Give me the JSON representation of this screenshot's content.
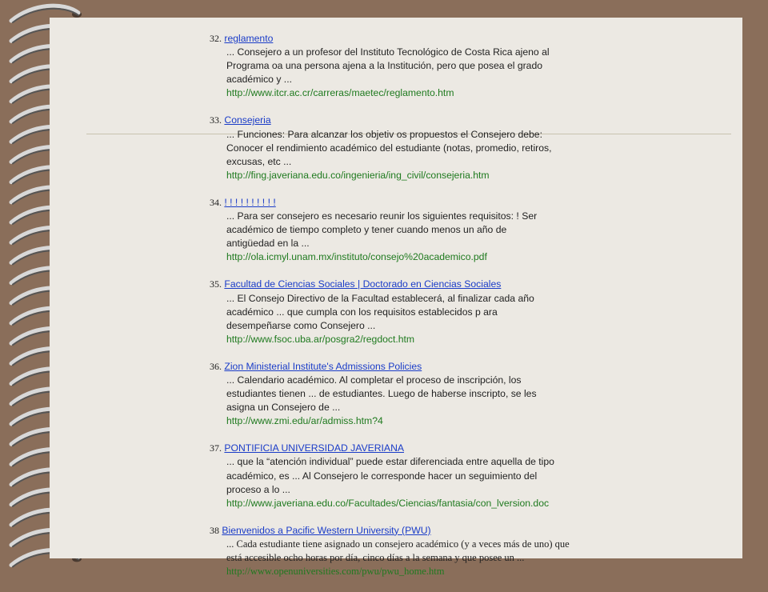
{
  "entries": [
    {
      "number": "32.",
      "title": "reglamento",
      "lines": [
        "... Consejero a un profesor del Instituto Tecnológico de Costa Rica ajeno al",
        "Programa oa una persona ajena a la Institución, pero que posea el grado",
        "académico y ..."
      ],
      "url": "http://www.itcr.ac.cr/carreras/maetec/reglamento.htm"
    },
    {
      "number": "33.",
      "title": "Consejeria",
      "lines": [
        "... Funciones: Para alcanzar los objetiv os propuestos el Consejero debe:",
        "Conocer el rendimiento académico del estudiante (notas, promedio, retiros,",
        "excusas, etc ..."
      ],
      "url": "http://fing.javeriana.edu.co/ingenieria/ing_civil/consejeria.htm"
    },
    {
      "number": "34.",
      "title": "! ! ! ! ! ! ! ! ! !",
      "lines": [
        "... Para ser consejero es necesario reunir los siguientes requisitos: ! Ser",
        "académico de tiempo completo y tener cuando menos un año de",
        "antigüedad en la ..."
      ],
      "url": "http://ola.icmyl.unam.mx/instituto/consejo%20academico.pdf"
    },
    {
      "number": "35.",
      "title": "Facultad de Ciencias Sociales | Doctorado en Ciencias Sociales",
      "lines": [
        "... El Consejo Directivo de la Facultad establecerá, al finalizar cada año",
        "académico ... que cumpla con los requisitos establecidos p ara",
        "desempeñarse como Consejero ..."
      ],
      "url": "http://www.fsoc.uba.ar/posgra2/regdoct.htm"
    },
    {
      "number": "36.",
      "title": "Zion Ministerial Institute's Admissions Policies",
      "lines": [
        "... Calendario académico. Al completar el proceso de inscripción, los",
        "estudiantes tienen ... de estudiantes. Luego de haberse inscripto, se les",
        "asigna un Consejero de ..."
      ],
      "url": "http://www.zmi.edu/ar/admiss.htm?4"
    },
    {
      "number": "37.",
      "title": "PONTIFICIA UNIVERSIDAD JAVERIANA",
      "lines": [
        "... que la “atención individual” puede estar diferenciada entre aquella de tipo",
        "académico, es ... Al Consejero le corresponde hacer un seguimiento del",
        "proceso a lo ..."
      ],
      "url": "http://www.javeriana.edu.co/Facultades/Ciencias/fantasia/con_lversion.doc"
    },
    {
      "number": "38",
      "title": "Bienvenidos a Pacific Western University (PWU)",
      "lines": [
        "... Cada estudiante tiene asignado un consejero académico (y a veces más de uno) que",
        "está accesible ocho horas por día, cinco días a la semana y que posee un ..."
      ],
      "url": "http://www.openuniversities.com/pwu/pwu_home.htm"
    }
  ]
}
